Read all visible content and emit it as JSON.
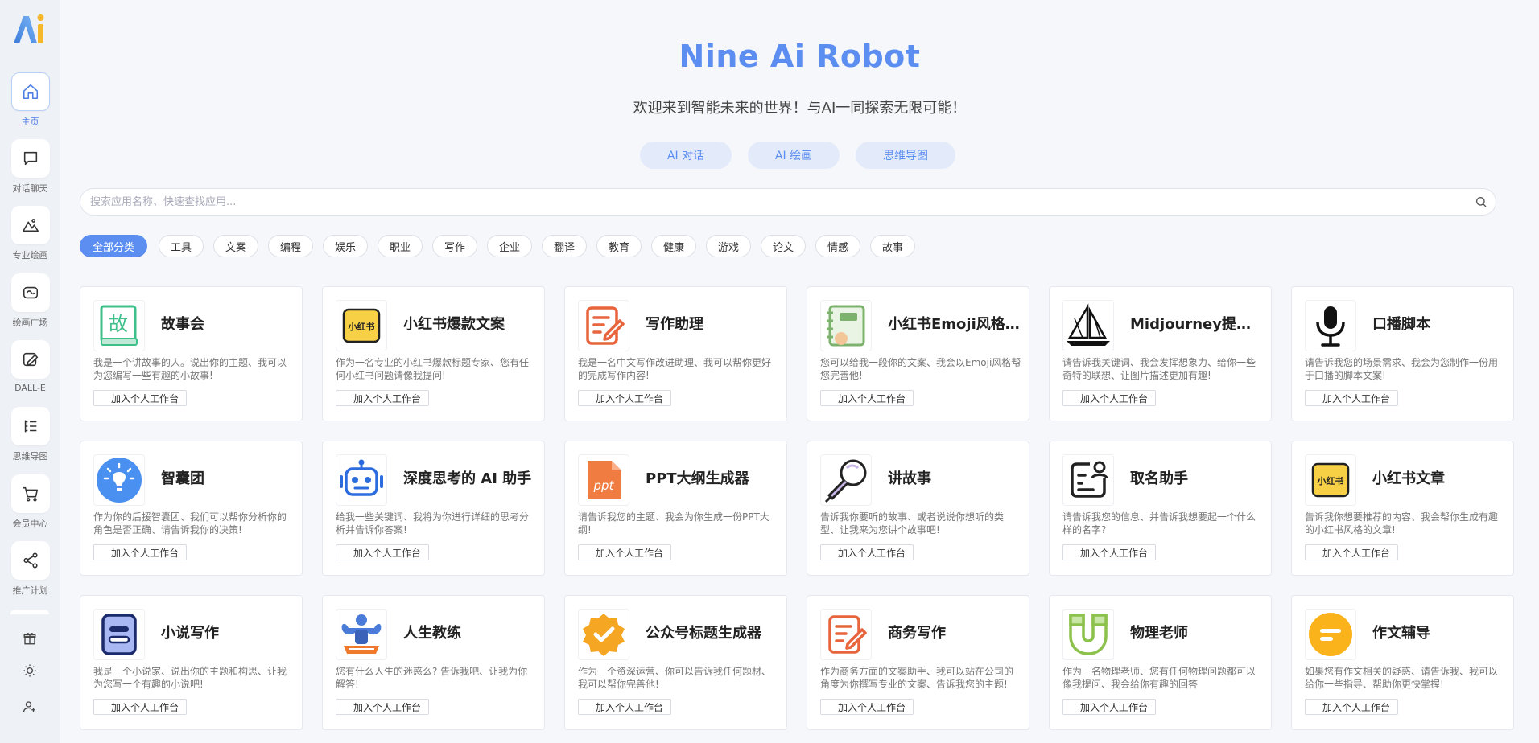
{
  "sidebar": {
    "items": [
      {
        "label": "主页",
        "icon": "home-icon"
      },
      {
        "label": "对话聊天",
        "icon": "chat-icon"
      },
      {
        "label": "专业绘画",
        "icon": "mountain-icon"
      },
      {
        "label": "绘画广场",
        "icon": "gallery-icon"
      },
      {
        "label": "DALL-E",
        "icon": "edit-image-icon"
      },
      {
        "label": "思维导图",
        "icon": "mindmap-icon"
      },
      {
        "label": "会员中心",
        "icon": "cart-icon"
      },
      {
        "label": "推广计划",
        "icon": "share-icon"
      }
    ],
    "bottom_icons": [
      "gift-icon",
      "sun-icon",
      "user-add-icon"
    ]
  },
  "hero": {
    "title": "Nine Ai Robot",
    "subtitle": "欢迎来到智能未来的世界！与AI一同探索无限可能！",
    "buttons": [
      "AI 对话",
      "AI 绘画",
      "思维导图"
    ]
  },
  "search": {
    "placeholder": "搜索应用名称、快速查找应用...",
    "value": ""
  },
  "categories": [
    "全部分类",
    "工具",
    "文案",
    "编程",
    "娱乐",
    "职业",
    "写作",
    "企业",
    "翻译",
    "教育",
    "健康",
    "游戏",
    "论文",
    "情感",
    "故事"
  ],
  "add_label": "加入个人工作台",
  "apps": [
    {
      "title": "故事会",
      "desc": "我是一个讲故事的人。说出你的主题、我可以为您编写一些有趣的小故事!",
      "icon": "book-icon"
    },
    {
      "title": "小红书爆款文案",
      "desc": "作为一名专业的小红书爆款标题专家、您有任何小红书问题请像我提问!",
      "icon": "xiaohongshu-icon",
      "icon_text": "小红书"
    },
    {
      "title": "写作助理",
      "desc": "我是一名中文写作改进助理、我可以帮你更好的完成写作内容!",
      "icon": "writing-icon"
    },
    {
      "title": "小红书Emoji风格文案",
      "desc": "您可以给我一段你的文案、我会以Emoji风格帮您完善他!",
      "icon": "notebook-icon"
    },
    {
      "title": "Midjourney提示词生成",
      "desc": "请告诉我关键词、我会发挥想象力、给你一些奇特的联想、让图片描述更加有趣!",
      "icon": "sailboat-icon"
    },
    {
      "title": "口播脚本",
      "desc": "请告诉我您的场景需求、我会为您制作一份用于口播的脚本文案!",
      "icon": "microphone-icon"
    },
    {
      "title": "智囊团",
      "desc": "作为你的后援智囊团、我们可以帮你分析你的角色是否正确、请告诉我你的决策!",
      "icon": "lightbulb-icon"
    },
    {
      "title": "深度思考的 AI 助手",
      "desc": "给我一些关键词、我将为你进行详细的思考分析并告诉你答案!",
      "icon": "robot-icon"
    },
    {
      "title": "PPT大纲生成器",
      "desc": "请告诉我您的主题、我会为你生成一份PPT大纲!",
      "icon": "ppt-icon",
      "icon_text": "ppt"
    },
    {
      "title": "讲故事",
      "desc": "告诉我你要听的故事、或者说说你想听的类型、让我来为您讲个故事吧!",
      "icon": "karaoke-mic-icon"
    },
    {
      "title": "取名助手",
      "desc": "请告诉我您的信息、并告诉我想要起一个什么样的名字?",
      "icon": "name-card-icon"
    },
    {
      "title": "小红书文章",
      "desc": "告诉我你想要推荐的内容、我会帮你生成有趣的小红书风格的文章!",
      "icon": "xiaohongshu-icon",
      "icon_text": "小红书"
    },
    {
      "title": "小说写作",
      "desc": "我是一个小说家、说出你的主题和构思、让我为您写一个有趣的小说吧!",
      "icon": "document-icon"
    },
    {
      "title": "人生教练",
      "desc": "您有什么人生的迷惑么? 告诉我吧、让我为你解答!",
      "icon": "muscle-icon"
    },
    {
      "title": "公众号标题生成器",
      "desc": "作为一个资深运营、你可以告诉我任何题材、我可以帮你完善他!",
      "icon": "badge-check-icon"
    },
    {
      "title": "商务写作",
      "desc": "作为商务方面的文案助手、我可以站在公司的角度为你撰写专业的文案、告诉我您的主题!",
      "icon": "writing-icon"
    },
    {
      "title": "物理老师",
      "desc": "作为一名物理老师、您有任何物理问题都可以像我提问、我会给你有趣的回答",
      "icon": "magnet-icon"
    },
    {
      "title": "作文辅导",
      "desc": "如果您有作文相关的疑惑、请告诉我、我可以给你一些指导、帮助你更快掌握!",
      "icon": "message-icon"
    }
  ],
  "colors": {
    "accent": "#5b8ef0",
    "sidebar_bg": "#eef1f6",
    "main_bg": "#f6f7fa"
  }
}
